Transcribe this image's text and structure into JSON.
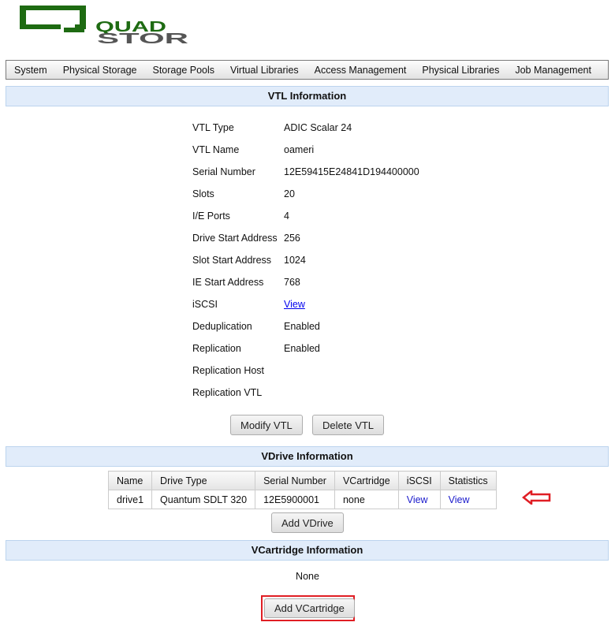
{
  "logo": {
    "line1": "QUAD",
    "line2": "STOR",
    "green": "#1e6b12",
    "gray": "#555555"
  },
  "nav": [
    "System",
    "Physical Storage",
    "Storage Pools",
    "Virtual Libraries",
    "Access Management",
    "Physical Libraries",
    "Job Management"
  ],
  "vtl": {
    "title": "VTL Information",
    "rows": [
      {
        "label": "VTL Type",
        "value": "ADIC Scalar 24"
      },
      {
        "label": "VTL Name",
        "value": "oameri"
      },
      {
        "label": "Serial Number",
        "value": "12E59415E24841D194400000"
      },
      {
        "label": "Slots",
        "value": "20"
      },
      {
        "label": "I/E Ports",
        "value": "4"
      },
      {
        "label": "Drive Start Address",
        "value": "256"
      },
      {
        "label": "Slot Start Address",
        "value": "1024"
      },
      {
        "label": "IE Start Address",
        "value": "768"
      },
      {
        "label": "iSCSI",
        "value": "View",
        "link": true
      },
      {
        "label": "Deduplication",
        "value": "Enabled"
      },
      {
        "label": "Replication",
        "value": "Enabled"
      },
      {
        "label": "Replication Host",
        "value": ""
      },
      {
        "label": "Replication VTL",
        "value": ""
      }
    ],
    "modify_label": "Modify VTL",
    "delete_label": "Delete VTL"
  },
  "vdrive": {
    "title": "VDrive Information",
    "columns": [
      "Name",
      "Drive Type",
      "Serial Number",
      "VCartridge",
      "iSCSI",
      "Statistics"
    ],
    "rows": [
      [
        "drive1",
        "Quantum SDLT 320",
        "12E5900001",
        "none",
        "View",
        "View"
      ]
    ],
    "add_label": "Add VDrive"
  },
  "vcartridge": {
    "title": "VCartridge Information",
    "empty_text": "None",
    "add_label": "Add VCartridge"
  },
  "annotation_color": "#e01e24"
}
